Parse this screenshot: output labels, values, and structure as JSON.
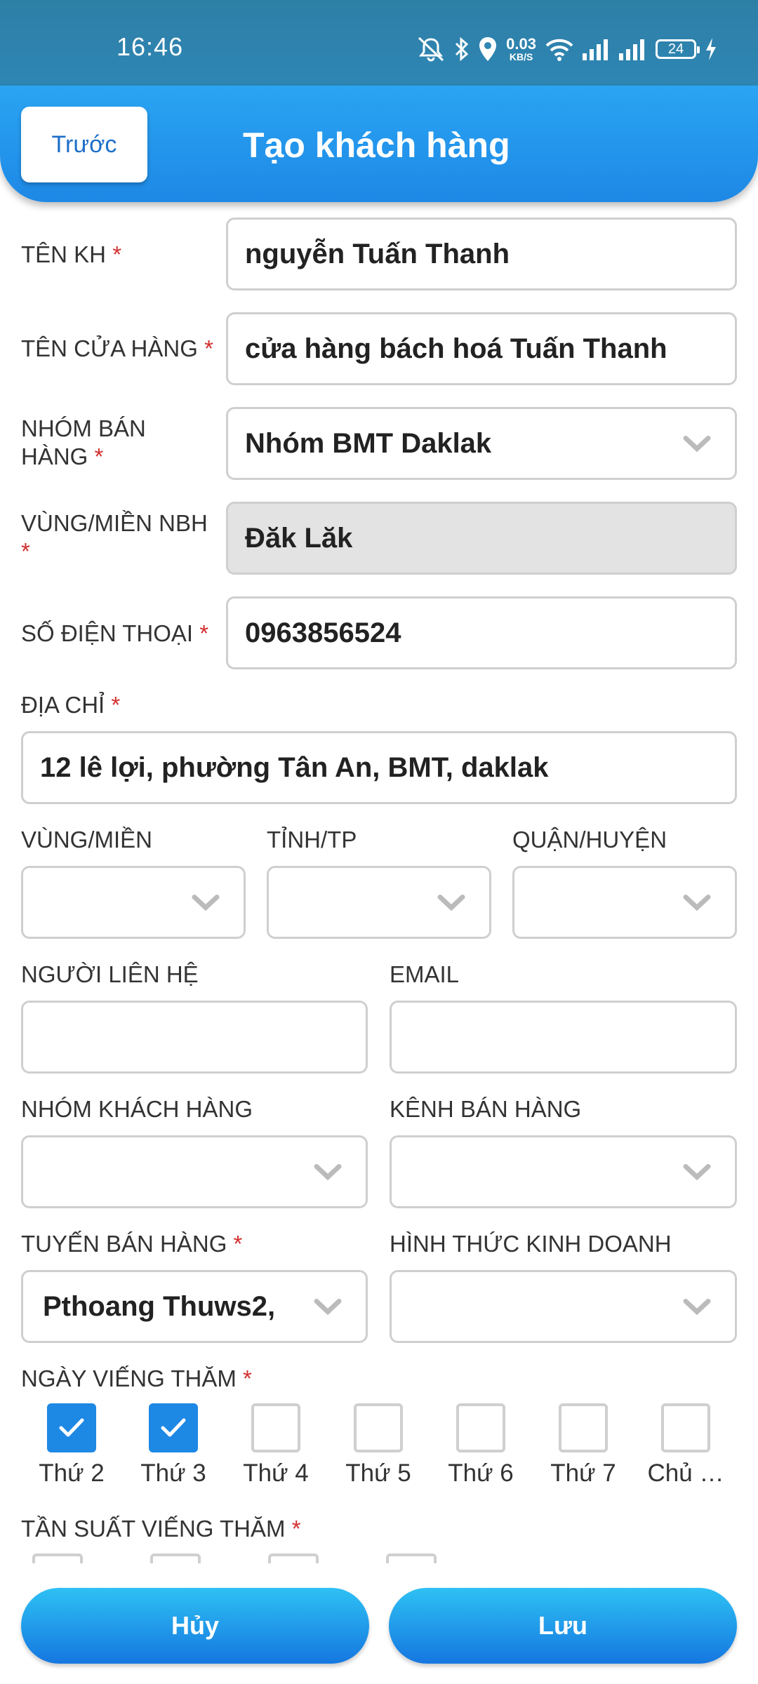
{
  "status_bar": {
    "time": "16:46",
    "net_speed_value": "0.03",
    "net_speed_unit": "KB/S",
    "battery": "24"
  },
  "header": {
    "back_label": "Trước",
    "title": "Tạo khách hàng"
  },
  "form": {
    "customer_name": {
      "label": "TÊN KH",
      "value": "nguyễn Tuấn Thanh"
    },
    "store_name": {
      "label": "TÊN CỬA HÀNG",
      "value": "cửa hàng bách hoá Tuấn Thanh"
    },
    "sales_group": {
      "label_line1": "NHÓM BÁN",
      "label_line2": "HÀNG",
      "value": "Nhóm BMT Daklak"
    },
    "sales_region": {
      "label": "VÙNG/MIỀN NBH",
      "value": "Đăk Lăk"
    },
    "phone": {
      "label": "SỐ ĐIỆN THOẠI",
      "value": "0963856524"
    },
    "address": {
      "label": "ĐỊA CHỈ",
      "value": "12 lê lợi, phường Tân An, BMT, daklak"
    },
    "region": {
      "label": "VÙNG/MIỀN",
      "value": ""
    },
    "province": {
      "label": "TỈNH/TP",
      "value": ""
    },
    "district": {
      "label": "QUẬN/HUYỆN",
      "value": ""
    },
    "contact_person": {
      "label": "NGƯỜI LIÊN HỆ",
      "value": ""
    },
    "email": {
      "label": "EMAIL",
      "value": ""
    },
    "customer_group": {
      "label": "NHÓM KHÁCH HÀNG",
      "value": ""
    },
    "sales_channel": {
      "label": "KÊNH BÁN HÀNG",
      "value": ""
    },
    "sales_route": {
      "label": "TUYẾN BÁN HÀNG",
      "value": "Pthoang Thuws2,"
    },
    "business_type": {
      "label": "HÌNH THỨC KINH DOANH",
      "value": ""
    },
    "visit_days": {
      "label": "NGÀY VIẾNG THĂM",
      "days": [
        {
          "label": "Thứ 2",
          "checked": true
        },
        {
          "label": "Thứ 3",
          "checked": true
        },
        {
          "label": "Thứ 4",
          "checked": false
        },
        {
          "label": "Thứ 5",
          "checked": false
        },
        {
          "label": "Thứ 6",
          "checked": false
        },
        {
          "label": "Thứ 7",
          "checked": false
        },
        {
          "label": "Chủ …",
          "checked": false
        }
      ]
    },
    "visit_frequency": {
      "label": "TẦN SUẤT VIẾNG THĂM"
    }
  },
  "actions": {
    "cancel_label": "Hủy",
    "save_label": "Lưu"
  },
  "colors": {
    "accent": "#1e88e5",
    "required": "#d32f2f",
    "status_bar": "#2f86b4"
  }
}
